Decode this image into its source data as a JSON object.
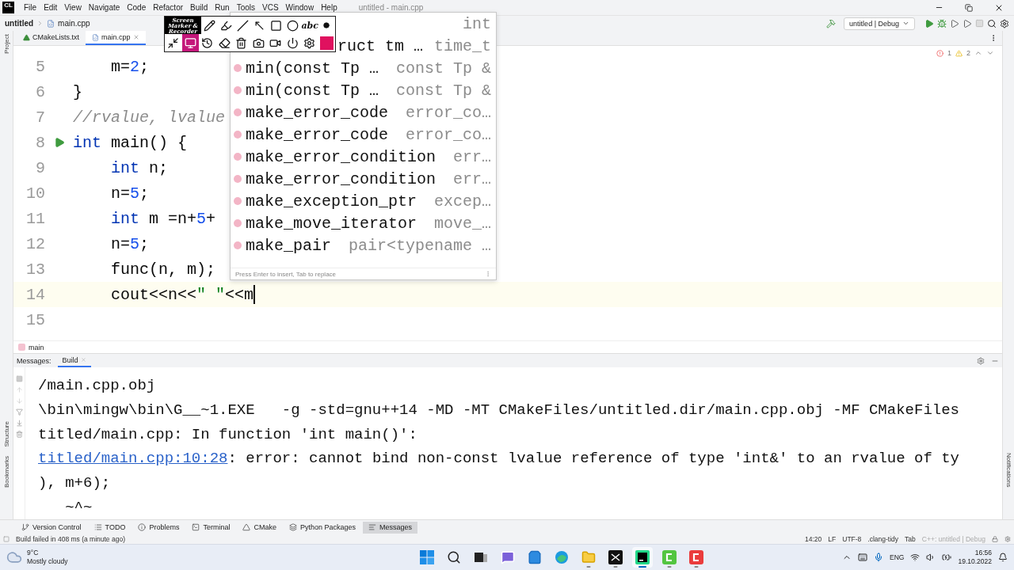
{
  "window": {
    "app_logo": "CL",
    "title": "untitled - main.cpp"
  },
  "menu": [
    "File",
    "Edit",
    "View",
    "Navigate",
    "Code",
    "Refactor",
    "Build",
    "Run",
    "Tools",
    "VCS",
    "Window",
    "Help"
  ],
  "navbar": {
    "breadcrumbs": [
      "untitled",
      "main.cpp"
    ],
    "run_config": "untitled | Debug"
  },
  "editor_tabs": [
    {
      "label": "CMakeLists.txt",
      "kind": "cmake",
      "selected": false
    },
    {
      "label": "main.cpp",
      "kind": "cpp",
      "selected": true
    }
  ],
  "side_tools": {
    "left_top": [
      "Project"
    ],
    "left_bottom": [
      "Structure",
      "Bookmarks"
    ],
    "right": [
      "Notifications"
    ]
  },
  "editor": {
    "errors": "1",
    "warnings": "2",
    "lines": [
      {
        "number": "5",
        "current": false,
        "run_marker": false,
        "caret": false,
        "tokens": [
          {
            "kind": "plain",
            "text": "    m="
          },
          {
            "kind": "num",
            "text": "2"
          },
          {
            "kind": "plain",
            "text": ";"
          }
        ]
      },
      {
        "number": "6",
        "current": false,
        "run_marker": false,
        "caret": false,
        "tokens": [
          {
            "kind": "plain",
            "text": "}"
          }
        ]
      },
      {
        "number": "7",
        "current": false,
        "run_marker": false,
        "caret": false,
        "tokens": [
          {
            "kind": "comment",
            "text": "//rvalue, lvalue"
          }
        ]
      },
      {
        "number": "8",
        "current": false,
        "run_marker": true,
        "caret": false,
        "tokens": [
          {
            "kind": "kw",
            "text": "int"
          },
          {
            "kind": "plain",
            "text": " main() {"
          }
        ]
      },
      {
        "number": "9",
        "current": false,
        "run_marker": false,
        "caret": false,
        "tokens": [
          {
            "kind": "kw",
            "text": "    int"
          },
          {
            "kind": "plain",
            "text": " n;"
          }
        ]
      },
      {
        "number": "10",
        "current": false,
        "run_marker": false,
        "caret": false,
        "tokens": [
          {
            "kind": "plain",
            "text": "    n="
          },
          {
            "kind": "num",
            "text": "5"
          },
          {
            "kind": "plain",
            "text": ";"
          }
        ]
      },
      {
        "number": "11",
        "current": false,
        "run_marker": false,
        "caret": false,
        "tokens": [
          {
            "kind": "kw",
            "text": "    int"
          },
          {
            "kind": "plain",
            "text": " m =n+"
          },
          {
            "kind": "num",
            "text": "5"
          },
          {
            "kind": "plain",
            "text": "+"
          }
        ]
      },
      {
        "number": "12",
        "current": false,
        "run_marker": false,
        "caret": false,
        "tokens": [
          {
            "kind": "plain",
            "text": "    n="
          },
          {
            "kind": "num",
            "text": "5"
          },
          {
            "kind": "plain",
            "text": ";"
          }
        ]
      },
      {
        "number": "13",
        "current": false,
        "run_marker": false,
        "caret": false,
        "tokens": [
          {
            "kind": "plain",
            "text": "    func(n, m);"
          }
        ]
      },
      {
        "number": "14",
        "current": true,
        "run_marker": false,
        "caret": true,
        "tokens": [
          {
            "kind": "plain",
            "text": "    cout<<n<<"
          },
          {
            "kind": "str",
            "text": "\" \""
          },
          {
            "kind": "plain",
            "text": "<<m"
          }
        ]
      },
      {
        "number": "15",
        "current": false,
        "run_marker": false,
        "caret": false
      }
    ],
    "breadcrumb": "main"
  },
  "completion": {
    "header_type": "int",
    "partial_row": {
      "name": "ruct tm …",
      "type": "time_t"
    },
    "items": [
      {
        "name": "min(const Tp …",
        "type": "const Tp &"
      },
      {
        "name": "min(const Tp …",
        "type": "const Tp &"
      },
      {
        "name": "make_error_code",
        "type": "error_co…"
      },
      {
        "name": "make_error_code",
        "type": "error_co…"
      },
      {
        "name": "make_error_condition",
        "type": "err…"
      },
      {
        "name": "make_error_condition",
        "type": "err…"
      },
      {
        "name": "make_exception_ptr",
        "type": "excep…"
      },
      {
        "name": "make_move_iterator",
        "type": "move_…"
      },
      {
        "name": "make_pair",
        "type": "pair<typename …"
      }
    ],
    "hint": "Press Enter to insert, Tab to replace"
  },
  "screen_marker": {
    "logo": "Screen Marker & Recorder",
    "rows": [
      [
        {
          "kind": "pencil",
          "selected": false
        },
        {
          "kind": "marker",
          "selected": false
        },
        {
          "kind": "line",
          "selected": false
        },
        {
          "kind": "arrow",
          "selected": false
        },
        {
          "kind": "rect",
          "selected": false
        },
        {
          "kind": "circle",
          "selected": false
        },
        {
          "kind": "text",
          "label": "abc",
          "selected": false
        },
        {
          "kind": "dot",
          "selected": false
        }
      ],
      [
        {
          "kind": "collapse",
          "selected": false
        },
        {
          "kind": "screen",
          "selected": true
        },
        {
          "kind": "history",
          "selected": false
        },
        {
          "kind": "eraser",
          "selected": false
        },
        {
          "kind": "trash",
          "selected": false
        },
        {
          "kind": "camera",
          "selected": false
        },
        {
          "kind": "video",
          "selected": false
        },
        {
          "kind": "power",
          "selected": false
        },
        {
          "kind": "gear",
          "selected": false
        },
        {
          "kind": "color",
          "selected": false
        }
      ]
    ]
  },
  "messages": {
    "label": "Messages:",
    "tabs": [
      {
        "label": "Build",
        "selected": true
      }
    ],
    "lines": [
      {
        "text": "/main.cpp.obj"
      },
      {
        "text": "\\bin\\mingw\\bin\\G__~1.EXE   -g -std=gnu++14 -MD -MT CMakeFiles/untitled.dir/main.cpp.obj -MF CMakeFiles"
      },
      {
        "text": "titled/main.cpp: In function 'int main()':"
      },
      {
        "link": "titled/main.cpp:10:28",
        "text": ": error: cannot bind non-const lvalue reference of type 'int&' to an rvalue of ty"
      },
      {
        "text": "), m+6);"
      },
      {
        "text": "   ~^~"
      }
    ]
  },
  "tool_windows": [
    {
      "label": "Version Control",
      "kind": "vcs",
      "selected": false
    },
    {
      "label": "TODO",
      "kind": "todo",
      "selected": false
    },
    {
      "label": "Problems",
      "kind": "problems",
      "selected": false
    },
    {
      "label": "Terminal",
      "kind": "terminal",
      "selected": false
    },
    {
      "label": "CMake",
      "kind": "cmake",
      "selected": false
    },
    {
      "label": "Python Packages",
      "kind": "packages",
      "selected": false
    },
    {
      "label": "Messages",
      "kind": "messages",
      "selected": true
    }
  ],
  "status_bar": {
    "message": "Build failed in 408 ms (a minute ago)",
    "items": [
      "14:20",
      "LF",
      "UTF-8",
      ".clang-tidy",
      "Tab"
    ],
    "context": "C++: untitled | Debug"
  },
  "taskbar": {
    "weather": {
      "temp": "9°C",
      "desc": "Mostly cloudy"
    },
    "apps": [
      {
        "kind": "start",
        "running": false
      },
      {
        "kind": "search",
        "running": false
      },
      {
        "kind": "taskview",
        "running": false
      },
      {
        "kind": "chat",
        "running": false
      },
      {
        "kind": "store",
        "running": false
      },
      {
        "kind": "edge",
        "running": false
      },
      {
        "kind": "explorer",
        "running": true
      },
      {
        "kind": "marker",
        "running": true
      },
      {
        "kind": "clion",
        "running": true
      },
      {
        "kind": "green",
        "running": true
      },
      {
        "kind": "red",
        "running": true
      }
    ],
    "language": "ENG",
    "time": "16:56",
    "date": "19.10.2022"
  }
}
